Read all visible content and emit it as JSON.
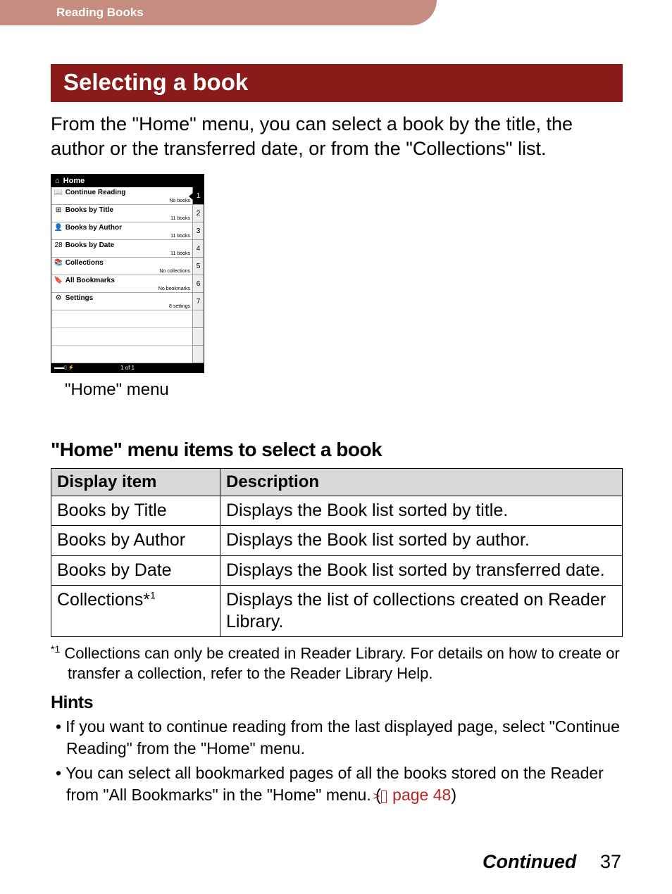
{
  "header": {
    "section": "Reading Books"
  },
  "title": "Selecting a book",
  "intro": "From the \"Home\" menu, you can select a book by the title, the author or the transferred date, or from the \"Collections\" list.",
  "screenshot": {
    "header": "Home",
    "items": [
      {
        "icon": "📖",
        "label": "Continue Reading",
        "sub": "No books"
      },
      {
        "icon": "⊞",
        "label": "Books by Title",
        "sub": "11 books"
      },
      {
        "icon": "👤",
        "label": "Books by Author",
        "sub": "11 books"
      },
      {
        "icon": "28",
        "label": "Books by Date",
        "sub": "11 books"
      },
      {
        "icon": "📚",
        "label": "Collections",
        "sub": "No collections"
      },
      {
        "icon": "🔖",
        "label": "All Bookmarks",
        "sub": "No bookmarks"
      },
      {
        "icon": "⚙",
        "label": "Settings",
        "sub": "8 settings"
      }
    ],
    "numbers": [
      "1",
      "2",
      "3",
      "4",
      "5",
      "6",
      "7",
      "",
      "",
      ""
    ],
    "footer_page": "1 of 1",
    "footer_batt": "▬▬▯ ⚡",
    "caption": "\"Home\" menu"
  },
  "subheading": "\"Home\" menu items to select a book",
  "table": {
    "headers": [
      "Display item",
      "Description"
    ],
    "rows": [
      [
        "Books by Title",
        "Displays the Book list sorted by title."
      ],
      [
        "Books by Author",
        "Displays the Book list sorted by author."
      ],
      [
        "Books by Date",
        "Displays the Book list sorted by transferred date."
      ],
      [
        "Collections*1",
        "Displays the list of collections created on Reader Library."
      ]
    ]
  },
  "footnote_mark": "*1",
  "footnote": "Collections can only be created in Reader Library. For details on how to create or transfer a collection, refer to the Reader Library Help.",
  "hints_title": "Hints",
  "hints": [
    "If you want to continue reading from the last displayed page, select \"Continue Reading\" from the \"Home\" menu.",
    "You can select all bookmarked pages of all the books stored on the Reader from \"All Bookmarks\" in the \"Home\" menu. "
  ],
  "page_link_text": "page 48",
  "footer": {
    "continued": "Continued",
    "page": "37"
  }
}
